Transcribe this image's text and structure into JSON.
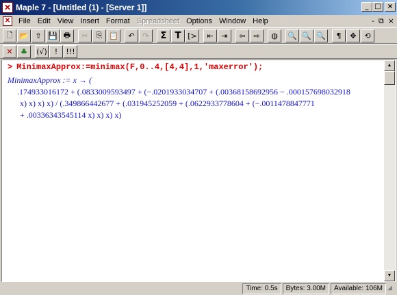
{
  "window": {
    "title": "Maple 7 - [Untitled (1) - [Server 1]]",
    "controls": {
      "minimize": "_",
      "maximize": "□",
      "close": "×"
    }
  },
  "menubar": {
    "items": [
      "File",
      "Edit",
      "View",
      "Insert",
      "Format",
      "Spreadsheet",
      "Options",
      "Window",
      "Help"
    ],
    "disabled": [
      "Spreadsheet"
    ],
    "mdi_controls": {
      "minimize": "-",
      "restore": "⧉",
      "close": "×"
    }
  },
  "toolbar": {
    "buttons": [
      {
        "name": "new-icon",
        "glyph": "🗋"
      },
      {
        "name": "open-icon",
        "glyph": "📂"
      },
      {
        "name": "open-url-icon",
        "glyph": "⇧"
      },
      {
        "name": "save-icon",
        "glyph": "💾"
      },
      {
        "name": "print-icon",
        "glyph": "🖶"
      },
      {
        "name": "cut-icon",
        "glyph": "✂",
        "dim": true
      },
      {
        "name": "copy-icon",
        "glyph": "⎘"
      },
      {
        "name": "paste-icon",
        "glyph": "📋"
      },
      {
        "name": "undo-icon",
        "glyph": "↶"
      },
      {
        "name": "redo-icon",
        "glyph": "↷",
        "dim": true
      },
      {
        "name": "math-input-icon",
        "glyph": "Σ"
      },
      {
        "name": "text-input-icon",
        "glyph": "T"
      },
      {
        "name": "insert-prompt-icon",
        "glyph": "[>"
      },
      {
        "name": "outdent-icon",
        "glyph": "⇤"
      },
      {
        "name": "indent-icon",
        "glyph": "⇥"
      },
      {
        "name": "back-icon",
        "glyph": "⇦"
      },
      {
        "name": "forward-icon",
        "glyph": "⇨"
      },
      {
        "name": "stop-icon",
        "glyph": "◍"
      },
      {
        "name": "zoom-100-icon",
        "glyph": "🔍"
      },
      {
        "name": "zoom-150-icon",
        "glyph": "🔍"
      },
      {
        "name": "zoom-200-icon",
        "glyph": "🔍"
      },
      {
        "name": "show-markers-icon",
        "glyph": "¶"
      },
      {
        "name": "expand-icon",
        "glyph": "✥"
      },
      {
        "name": "restart-icon",
        "glyph": "⟲"
      }
    ]
  },
  "toolbar2": {
    "buttons": [
      {
        "name": "close-context-icon",
        "glyph": "✕"
      },
      {
        "name": "maple-leaf-icon",
        "glyph": "♣"
      },
      {
        "name": "eval-icon",
        "glyph": "(√)"
      },
      {
        "name": "exclaim-icon",
        "glyph": "!"
      },
      {
        "name": "execute-all-icon",
        "glyph": "!!!"
      }
    ]
  },
  "worksheet": {
    "prompt": ">",
    "input": "MinimaxApprox:=minimax(F,0..4,[4,4],1,'maxerror');",
    "output": {
      "lhs": "MinimaxApprox",
      "line1": " := x → (",
      "line2": ".174933016172 + (.0833009593497 + (−.0201933034707 + (.00368158692956 − .000157698032918",
      "line3a": "x) x) x) x) / (.349866442677 + (.031945252059 + (.0622933778604 + (−.0011478847771",
      "line4": "+ .00336343545114",
      "line4b": " x) x) x) x)",
      "x": "x"
    }
  },
  "statusbar": {
    "time": "Time:   0.5s",
    "bytes": "Bytes: 3.00M",
    "available": "Available: 106M"
  }
}
